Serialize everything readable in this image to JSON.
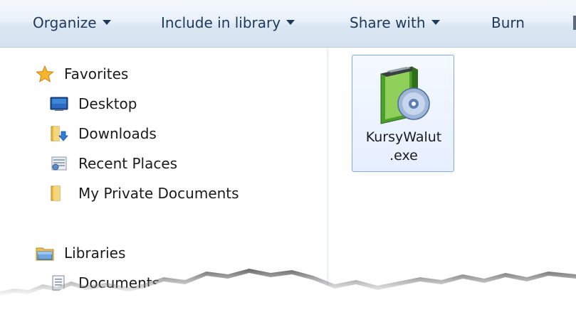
{
  "toolbar": {
    "organize": "Organize",
    "include_in_library": "Include in library",
    "share_with": "Share with",
    "burn": "Burn"
  },
  "nav": {
    "favorites": "Favorites",
    "items": [
      {
        "label": "Desktop",
        "icon": "desktop-icon"
      },
      {
        "label": "Downloads",
        "icon": "downloads-folder-icon"
      },
      {
        "label": "Recent Places",
        "icon": "recent-places-icon"
      },
      {
        "label": "My Private Documents",
        "icon": "folder-icon"
      }
    ],
    "libraries": "Libraries",
    "library_items": [
      {
        "label": "Documents",
        "icon": "documents-library-icon"
      }
    ]
  },
  "files": [
    {
      "name_line1": "KursyWalut",
      "name_line2": ".exe",
      "icon": "installer-exe-icon"
    }
  ],
  "colors": {
    "toolbar_text": "#1e395b",
    "selection_border": "#84acdd",
    "selection_fill": "#e6efff"
  }
}
